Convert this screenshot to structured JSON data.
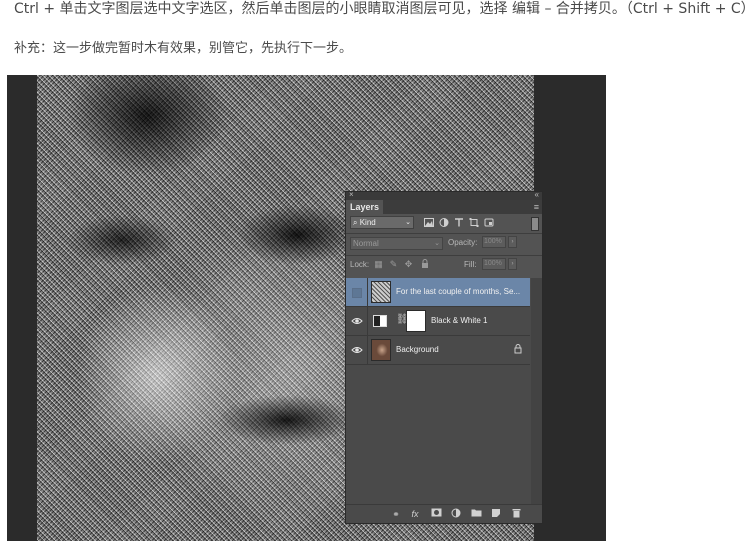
{
  "article": {
    "instruction": "Ctrl + 单击文字图层选中文字选区，然后单击图层的小眼睛取消图层可见，选择 编辑 – 合并拷贝。（Ctrl + Shift + C）",
    "note": "补充：这一步做完暂时木有效果，别管它，先执行下一步。"
  },
  "layers_panel": {
    "close_glyph": "×",
    "collapse_glyph": "«",
    "tab_label": "Layers",
    "menu_glyph": "≡",
    "filter": {
      "kind_label": "Kind",
      "kind_prefix": "⌕",
      "arrow": "⌄",
      "icons": [
        "image-filter-icon",
        "adjustment-filter-icon",
        "type-filter-icon",
        "shape-filter-icon",
        "smart-object-filter-icon"
      ]
    },
    "blend_mode": "Normal",
    "opacity_label": "Opacity:",
    "opacity_value": "100%",
    "lock_label": "Lock:",
    "fill_label": "Fill:",
    "fill_value": "100%",
    "layers": [
      {
        "name": "For the last couple of months, Se...",
        "visible": false,
        "selected": true,
        "type": "text"
      },
      {
        "name": "Black & White 1",
        "visible": true,
        "selected": false,
        "type": "adjustment"
      },
      {
        "name": "Background",
        "visible": true,
        "selected": false,
        "type": "image",
        "locked": true
      }
    ],
    "footer_icons": [
      "link-layers-icon",
      "fx-icon",
      "add-mask-icon",
      "new-fill-adjustment-icon",
      "new-group-icon",
      "new-layer-icon",
      "delete-layer-icon"
    ],
    "footer_fx": "fx"
  }
}
